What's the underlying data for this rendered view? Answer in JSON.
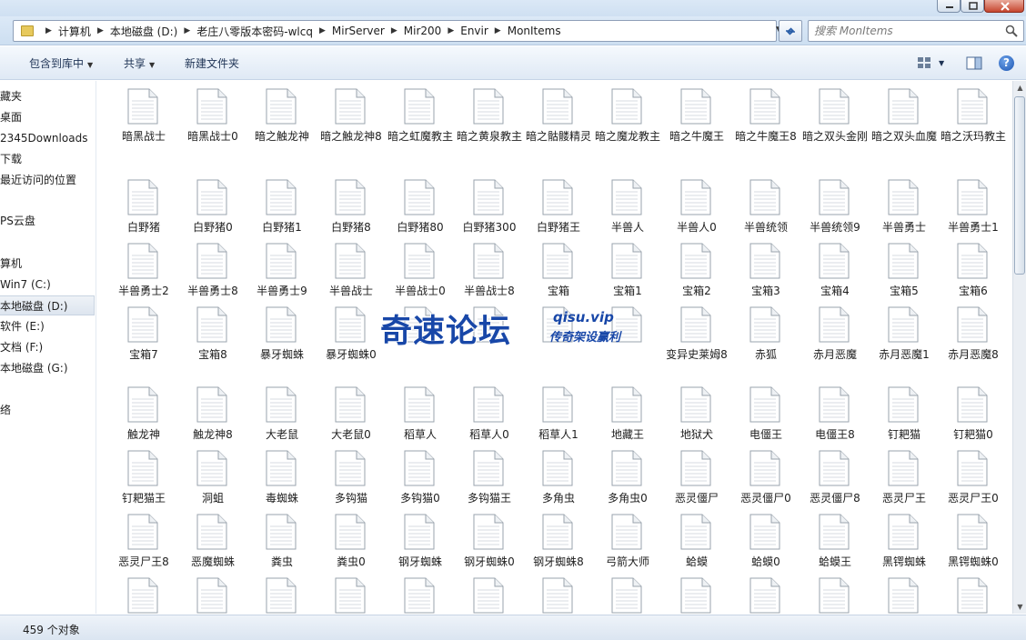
{
  "address_bar": {
    "breadcrumbs": [
      "计算机",
      "本地磁盘 (D:)",
      "老庄八零版本密码-wlcq",
      "MirServer",
      "Mir200",
      "Envir",
      "MonItems"
    ]
  },
  "search": {
    "placeholder": "搜索 MonItems"
  },
  "toolbar": {
    "include_library_label": "包含到库中",
    "share_label": "共享",
    "new_folder_label": "新建文件夹",
    "help_label": "?"
  },
  "nav_pane": {
    "items": [
      {
        "label": "藏夹"
      },
      {
        "label": "桌面"
      },
      {
        "label": "2345Downloads"
      },
      {
        "label": "下载"
      },
      {
        "label": "最近访问的位置"
      },
      {
        "label": "PS云盘"
      },
      {
        "label": "算机"
      },
      {
        "label": "Win7 (C:)"
      },
      {
        "label": "本地磁盘 (D:)"
      },
      {
        "label": "软件 (E:)"
      },
      {
        "label": "文档 (F:)"
      },
      {
        "label": "本地磁盘 (G:)"
      },
      {
        "label": "络"
      }
    ],
    "selected_index": 8
  },
  "files": [
    "暗黑战士",
    "暗黑战士0",
    "暗之触龙神",
    "暗之触龙神8",
    "暗之虹魔教主",
    "暗之黄泉教主",
    "暗之骷髅精灵",
    "暗之魔龙教主",
    "暗之牛魔王",
    "暗之牛魔王8",
    "暗之双头金刚",
    "暗之双头血魔",
    "暗之沃玛教主",
    "白野猪",
    "白野猪0",
    "白野猪1",
    "白野猪8",
    "白野猪80",
    "白野猪300",
    "白野猪王",
    "半兽人",
    "半兽人0",
    "半兽统领",
    "半兽统领9",
    "半兽勇士",
    "半兽勇士1",
    "半兽勇士2",
    "半兽勇士8",
    "半兽勇士9",
    "半兽战士",
    "半兽战士0",
    "半兽战士8",
    "宝箱",
    "宝箱1",
    "宝箱2",
    "宝箱3",
    "宝箱4",
    "宝箱5",
    "宝箱6",
    "宝箱7",
    "宝箱8",
    "暴牙蜘蛛",
    "暴牙蜘蛛0",
    "",
    "",
    "",
    "",
    "变异史莱姆8",
    "赤狐",
    "赤月恶魔",
    "赤月恶魔1",
    "赤月恶魔8",
    "触龙神",
    "触龙神8",
    "大老鼠",
    "大老鼠0",
    "稻草人",
    "稻草人0",
    "稻草人1",
    "地藏王",
    "地狱犬",
    "电僵王",
    "电僵王8",
    "钉耙猫",
    "钉耙猫0",
    "钉耙猫王",
    "洞蛆",
    "毒蜘蛛",
    "多钩猫",
    "多钩猫0",
    "多钩猫王",
    "多角虫",
    "多角虫0",
    "恶灵僵尸",
    "恶灵僵尸0",
    "恶灵僵尸8",
    "恶灵尸王",
    "恶灵尸王0",
    "恶灵尸王8",
    "恶魔蜘蛛",
    "粪虫",
    "粪虫0",
    "钢牙蜘蛛",
    "钢牙蜘蛛0",
    "钢牙蜘蛛8",
    "弓箭大师",
    "蛤蟆",
    "蛤蟆0",
    "蛤蟆王",
    "黑锷蜘蛛",
    "黑锷蜘蛛0",
    "",
    "",
    "",
    "",
    "",
    "",
    "",
    "",
    "",
    "",
    "",
    "",
    ""
  ],
  "status": {
    "item_count": "459 个对象"
  },
  "watermark": {
    "main": "奇速论坛",
    "url": "qisu.vip",
    "sub": "传奇架设赢利"
  },
  "colors": {
    "accent": "#1847a8",
    "toolbar": "#dfe9f5",
    "selection": "#dde5ef"
  }
}
